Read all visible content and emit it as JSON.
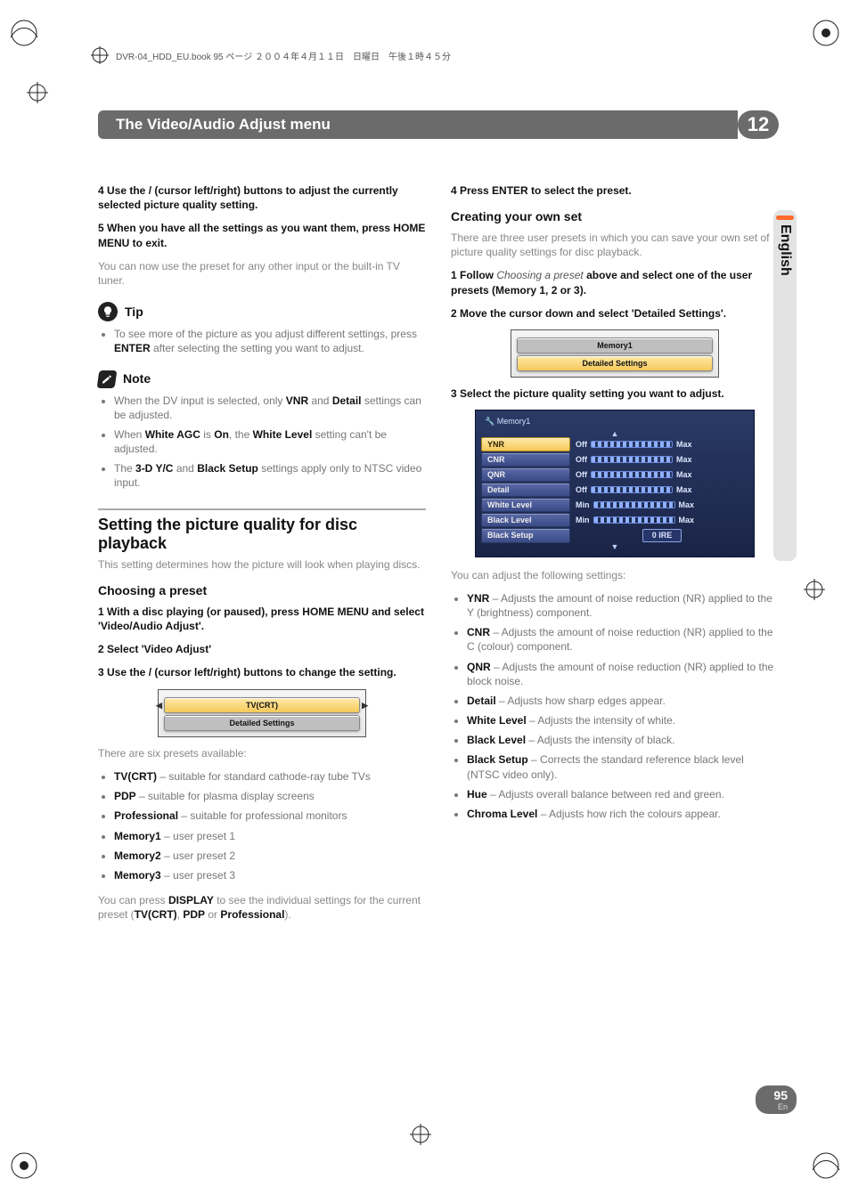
{
  "meta": {
    "header_line": "DVR-04_HDD_EU.book  95 ページ  ２００４年４月１１日　日曜日　午後１時４５分"
  },
  "chapter": {
    "title": "The Video/Audio Adjust menu",
    "number": "12"
  },
  "side": {
    "language": "English"
  },
  "footer": {
    "page": "95",
    "lang": "En"
  },
  "left": {
    "step4": "4    Use the  /  (cursor left/right) buttons to adjust the currently selected picture quality setting.",
    "step5": "5    When you have all the settings as you want them, press HOME MENU to exit.",
    "step5_body": "You can now use the preset for any other input or the built-in TV tuner.",
    "tip_label": "Tip",
    "tip_body_pre": "To see more of the picture as you adjust different settings, press ",
    "tip_body_bold": "ENTER",
    "tip_body_post": " after selecting the setting you want to adjust.",
    "note_label": "Note",
    "note1_pre": "When the DV input is selected, only ",
    "note1_b1": "VNR",
    "note1_mid": " and ",
    "note1_b2": "Detail",
    "note1_post": " settings can be adjusted.",
    "note2_pre": "When ",
    "note2_b1": "White AGC",
    "note2_mid": " is ",
    "note2_b2": "On",
    "note2_mid2": ", the ",
    "note2_b3": "White Level",
    "note2_post": " setting can't be adjusted.",
    "note3_pre": "The ",
    "note3_b1": "3-D Y/C",
    "note3_mid": " and ",
    "note3_b2": "Black Setup",
    "note3_post": " settings apply only to NTSC video input.",
    "h2": "Setting the picture quality for disc playback",
    "h2_body": "This setting determines how the picture will look when playing discs.",
    "h3": "Choosing a preset",
    "cp_step1": "1    With a disc playing (or paused), press HOME MENU and select 'Video/Audio Adjust'.",
    "cp_step2": "2    Select 'Video Adjust'",
    "cp_step3": "3    Use the  /  (cursor left/right) buttons to change the setting.",
    "osd1": {
      "row1": "TV(CRT)",
      "row2": "Detailed Settings"
    },
    "presets_intro": "There are six presets available:",
    "presets": [
      {
        "b": "TV(CRT)",
        "t": " – suitable for standard cathode-ray tube TVs"
      },
      {
        "b": "PDP",
        "t": " – suitable for plasma display screens"
      },
      {
        "b": "Professional",
        "t": " – suitable for professional monitors"
      },
      {
        "b": "Memory1",
        "t": " – user preset 1"
      },
      {
        "b": "Memory2",
        "t": " – user preset 2"
      },
      {
        "b": "Memory3",
        "t": " – user preset 3"
      }
    ],
    "presets_post_pre": "You can press ",
    "presets_post_b1": "DISPLAY",
    "presets_post_mid": " to see the individual settings for the current preset (",
    "presets_post_b2": "TV(CRT)",
    "presets_post_mid2": ", ",
    "presets_post_b3": "PDP",
    "presets_post_mid3": " or ",
    "presets_post_b4": "Professional",
    "presets_post_end": ")."
  },
  "right": {
    "step4": "4    Press ENTER to select the preset.",
    "h3": "Creating your own set",
    "intro": "There are three user presets in which you can save your own set of picture quality settings for disc playback.",
    "step1_pre": "1    Follow ",
    "step1_it": "Choosing a preset",
    "step1_post": " above and select one of the user presets (Memory 1, 2 or 3).",
    "step2": "2    Move the cursor down and select 'Detailed Settings'.",
    "osd2": {
      "row1": "Memory1",
      "row2": "Detailed Settings"
    },
    "step3": "3    Select the picture quality setting you want to adjust.",
    "osd3": {
      "title": "Memory1",
      "rows": [
        {
          "label": "YNR",
          "lvar": "Off",
          "rvar": "Max"
        },
        {
          "label": "CNR",
          "lvar": "Off",
          "rvar": "Max"
        },
        {
          "label": "QNR",
          "lvar": "Off",
          "rvar": "Max"
        },
        {
          "label": "Detail",
          "lvar": "Off",
          "rvar": "Max"
        },
        {
          "label": "White Level",
          "lvar": "Min",
          "rvar": "Max"
        },
        {
          "label": "Black Level",
          "lvar": "Min",
          "rvar": "Max"
        },
        {
          "label": "Black Setup",
          "ire": "0 IRE"
        }
      ]
    },
    "adjust_intro": "You can adjust the following settings:",
    "adjust": [
      {
        "b": "YNR",
        "t": " – Adjusts the amount of noise reduction (NR) applied to the Y (brightness) component."
      },
      {
        "b": "CNR",
        "t": " – Adjusts the amount of noise reduction (NR) applied to the C (colour) component."
      },
      {
        "b": "QNR",
        "t": " – Adjusts the amount of noise reduction (NR) applied to the block noise."
      },
      {
        "b": "Detail",
        "t": " – Adjusts how sharp edges appear."
      },
      {
        "b": "White Level",
        "t": " – Adjusts the intensity of white."
      },
      {
        "b": "Black Level",
        "t": " – Adjusts the intensity of black."
      },
      {
        "b": "Black Setup",
        "t": " – Corrects the standard reference black level (NTSC video only)."
      },
      {
        "b": "Hue",
        "t": " – Adjusts overall balance between red and green."
      },
      {
        "b": "Chroma Level",
        "t": " – Adjusts how rich the colours appear."
      }
    ]
  }
}
